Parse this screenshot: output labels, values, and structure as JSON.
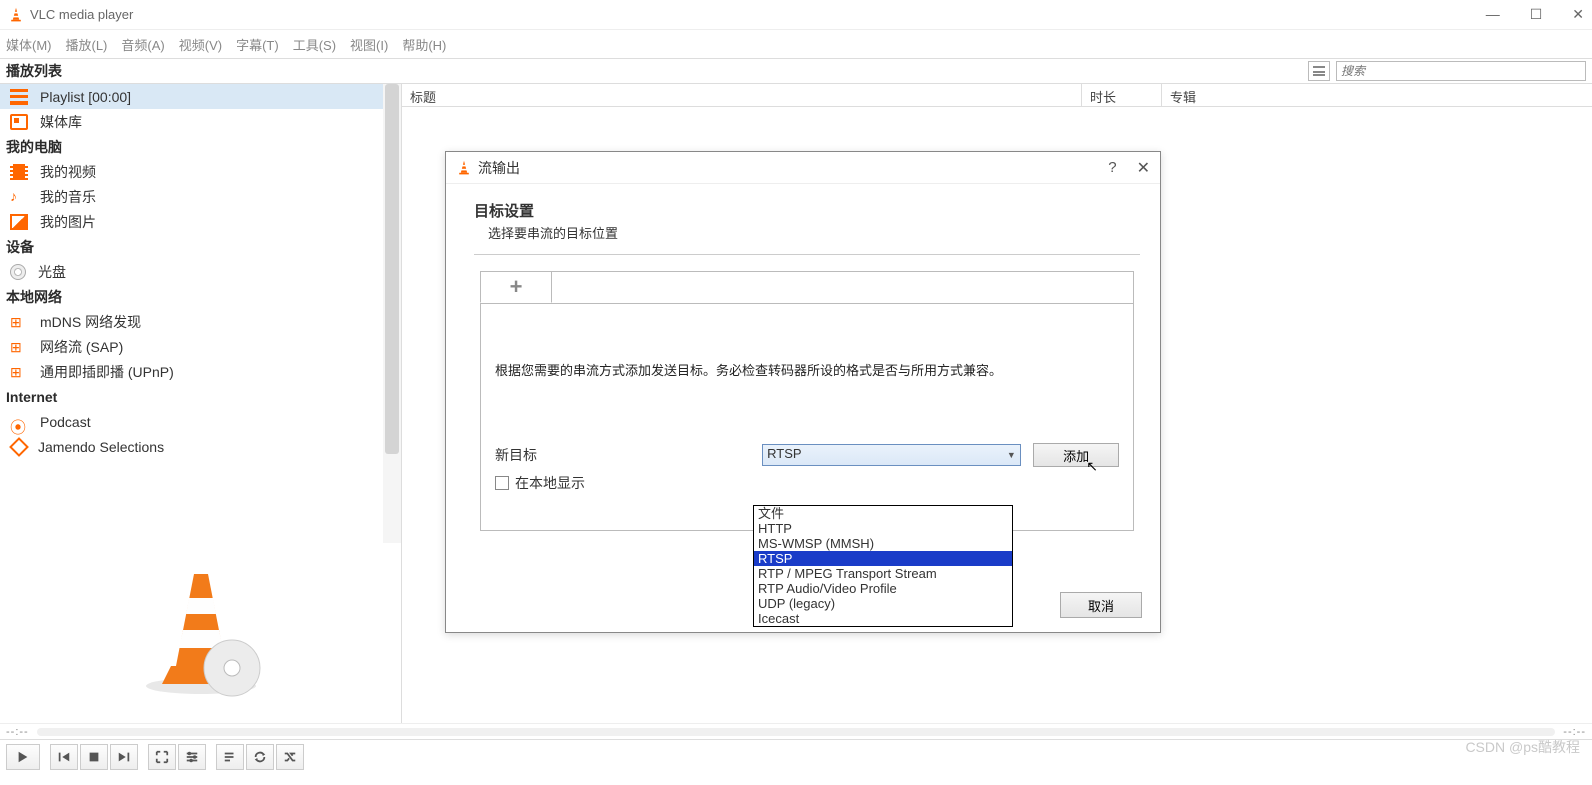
{
  "titlebar": {
    "title": "VLC media player"
  },
  "menubar": [
    "媒体(M)",
    "播放(L)",
    "音频(A)",
    "视频(V)",
    "字幕(T)",
    "工具(S)",
    "视图(I)",
    "帮助(H)"
  ],
  "topstrip": {
    "label": "播放列表",
    "search_placeholder": "搜索"
  },
  "sidebar": {
    "items": [
      {
        "type": "item",
        "icon": "list",
        "label": "Playlist [00:00]",
        "selected": true
      },
      {
        "type": "item",
        "icon": "lib",
        "label": "媒体库"
      },
      {
        "type": "cat",
        "label": "我的电脑"
      },
      {
        "type": "item",
        "icon": "vid",
        "label": "我的视频"
      },
      {
        "type": "item",
        "icon": "mus",
        "label": "我的音乐"
      },
      {
        "type": "item",
        "icon": "pic",
        "label": "我的图片"
      },
      {
        "type": "cat",
        "label": "设备"
      },
      {
        "type": "item",
        "icon": "disc",
        "label": "光盘"
      },
      {
        "type": "cat",
        "label": "本地网络"
      },
      {
        "type": "item",
        "icon": "net",
        "label": "mDNS 网络发现"
      },
      {
        "type": "item",
        "icon": "net",
        "label": "网络流 (SAP)"
      },
      {
        "type": "item",
        "icon": "net",
        "label": "通用即插即播  (UPnP)"
      },
      {
        "type": "cat",
        "label": "Internet"
      },
      {
        "type": "item",
        "icon": "pod",
        "label": "Podcast"
      },
      {
        "type": "item",
        "icon": "jam",
        "label": "Jamendo Selections"
      }
    ]
  },
  "columns": {
    "title": "标题",
    "duration": "时长",
    "album": "专辑"
  },
  "dialog": {
    "title": "流输出",
    "heading": "目标设置",
    "subheading": "选择要串流的目标位置",
    "note": "根据您需要的串流方式添加发送目标。务必检查转码器所设的格式是否与所用方式兼容。",
    "new_dest_label": "新目标",
    "selected": "RTSP",
    "add_label": "添加",
    "show_local_label": "在本地显示",
    "cancel_label": "取消",
    "options": [
      "文件",
      "HTTP",
      "MS-WMSP (MMSH)",
      "RTSP",
      "RTP / MPEG Transport Stream",
      "RTP Audio/Video Profile",
      "UDP (legacy)",
      "Icecast"
    ]
  },
  "seek": {
    "left": "--:--",
    "right": "--:--"
  },
  "watermark": "CSDN @ps酷教程"
}
